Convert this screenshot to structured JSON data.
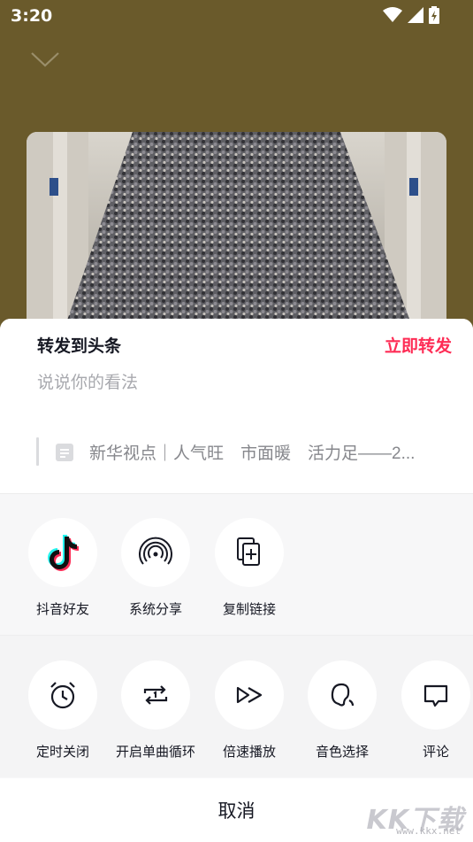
{
  "status_bar": {
    "time": "3:20"
  },
  "repost": {
    "title": "转发到头条",
    "action_label": "立即转发",
    "input_placeholder": "说说你的看法",
    "quoted_text": "新华视点｜人气旺　市面暖　活力足——2..."
  },
  "share_row": [
    {
      "label": "抖音好友",
      "icon": "douyin-logo-icon"
    },
    {
      "label": "系统分享",
      "icon": "broadcast-icon"
    },
    {
      "label": "复制链接",
      "icon": "copy-link-icon"
    }
  ],
  "player_row": [
    {
      "label": "定时关闭",
      "icon": "alarm-clock-icon"
    },
    {
      "label": "开启单曲循环",
      "icon": "repeat-one-icon"
    },
    {
      "label": "倍速播放",
      "icon": "speed-play-icon"
    },
    {
      "label": "音色选择",
      "icon": "voice-timbre-icon"
    },
    {
      "label": "评论",
      "icon": "comment-icon"
    }
  ],
  "cancel_label": "取消",
  "watermark": {
    "main": "KK下载",
    "sub": "www.kkx.net"
  },
  "colors": {
    "accent": "#fe2c55",
    "backdrop": "#6a5a2b",
    "sheet": "#f7f7f8"
  }
}
